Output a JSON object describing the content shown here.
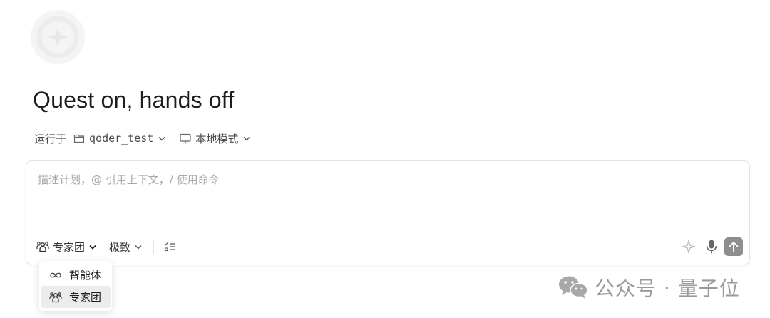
{
  "app_logo": {
    "icon": "sparkle-icon"
  },
  "title": "Quest on, hands off",
  "context": {
    "run_label": "运行于",
    "folder": {
      "icon": "folder-icon",
      "name": "qoder_test"
    },
    "mode": {
      "icon": "monitor-icon",
      "label": "本地模式"
    }
  },
  "composer": {
    "placeholder": "描述计划，@ 引用上下文，/ 使用命令",
    "value": ""
  },
  "toolbar": {
    "agent_mode": {
      "icon": "team-icon",
      "label": "专家团"
    },
    "speed": {
      "label": "极致"
    },
    "plan_icon": "checklist-icon",
    "enhance_icon": "sparkle-icon",
    "mic_icon": "microphone-icon",
    "send_icon": "arrow-up-icon"
  },
  "agent_mode_menu": {
    "items": [
      {
        "label": "智能体",
        "icon": "infinity-icon",
        "selected": false
      },
      {
        "label": "专家团",
        "icon": "team-icon",
        "selected": true
      }
    ]
  },
  "watermark": {
    "text": "公众号 · 量子位",
    "icon": "wechat-icon"
  }
}
